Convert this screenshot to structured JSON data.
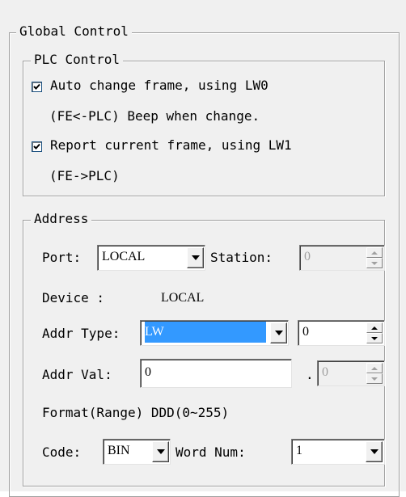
{
  "global_control": {
    "title": "Global Control"
  },
  "plc_control": {
    "title": "PLC Control",
    "auto_change": {
      "checked": true,
      "line1": "Auto change frame, using LW0",
      "line2": "(FE<-PLC) Beep when change."
    },
    "report_current": {
      "checked": true,
      "line1": "Report current frame, using LW1",
      "line2": "(FE->PLC)"
    }
  },
  "address": {
    "title": "Address",
    "port_label": "Port:",
    "port_value": "LOCAL",
    "station_label": "Station:",
    "station_value": "0",
    "device_label": "Device :",
    "device_value": "LOCAL",
    "addr_type_label": "Addr Type:",
    "addr_type_value": "LW",
    "addr_type_number": "0",
    "addr_val_label": "Addr Val:",
    "addr_val_value": "0",
    "addr_val_dot": ".",
    "addr_val_sub": "0",
    "format_label": "Format(Range) DDD(0~255)",
    "code_label": "Code:",
    "code_value": "BIN",
    "word_num_label": "Word Num:",
    "word_num_value": "1"
  },
  "colors": {
    "selection": "#3399ff",
    "panel": "#f0f0f0",
    "checkbox_border": "#1c5180"
  }
}
